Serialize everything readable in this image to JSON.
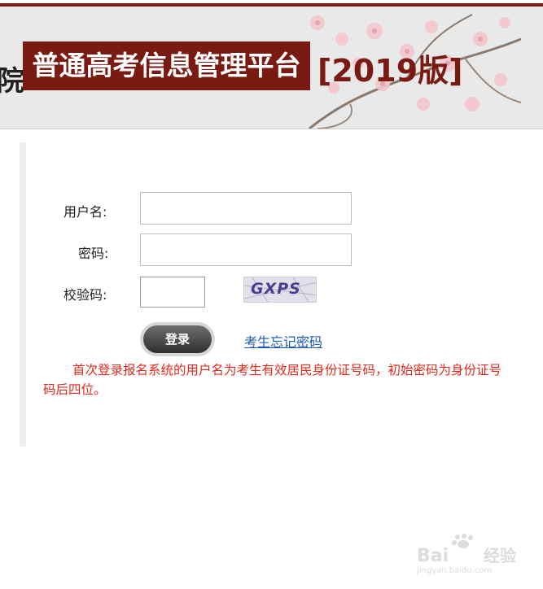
{
  "header": {
    "partial_text": "院",
    "title": "普通高考信息管理平台",
    "version": "[2019版]",
    "accent_color": "#7a1b13"
  },
  "form": {
    "username_label": "用户名:",
    "password_label": "密码:",
    "captcha_label": "校验码:",
    "captcha_text": "GXPS",
    "login_label": "登录",
    "forgot_label": "考生忘记密码"
  },
  "notice": "首次登录报名系统的用户名为考生有效居民身份证号码，初始密码为身份证号码后四位。",
  "watermark": {
    "brand": "Bai",
    "brand2": "经验",
    "url": "jingyan.baidu.com"
  }
}
